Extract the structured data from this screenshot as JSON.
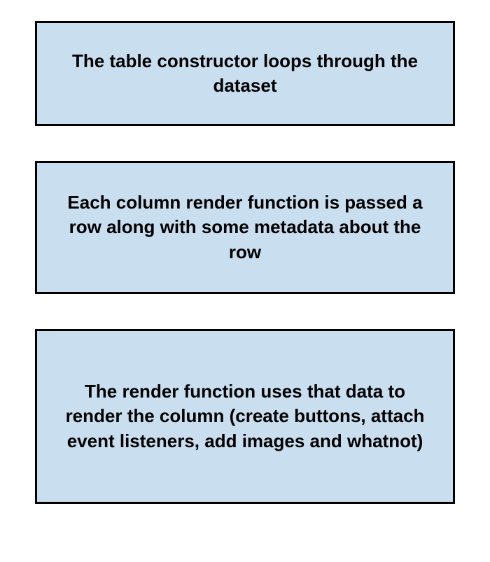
{
  "boxes": [
    {
      "text": "The table constructor loops through the dataset"
    },
    {
      "text": "Each column render function is passed a row along with some metadata about the row"
    },
    {
      "text": "The render function uses that data to render the column (create buttons, attach event listeners, add images and whatnot)"
    }
  ],
  "colors": {
    "box_fill": "#c9dff0",
    "box_border": "#000000",
    "text": "#000000"
  }
}
